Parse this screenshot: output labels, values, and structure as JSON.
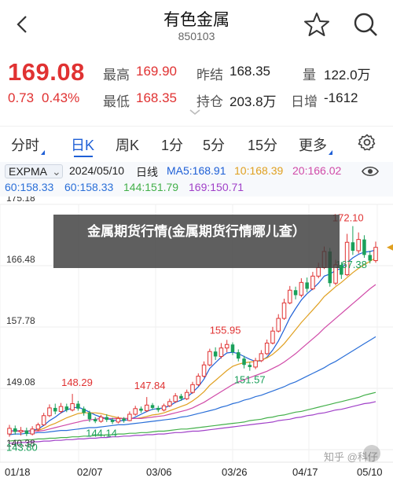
{
  "nav": {
    "title": "有色金属",
    "code": "850103"
  },
  "quote": {
    "price": "169.08",
    "change": "0.73",
    "change_pct": "0.43%",
    "high_label": "最高",
    "high": "169.90",
    "low_label": "最低",
    "low": "168.35",
    "prev_close_label": "昨结",
    "prev_close": "168.35",
    "open_int_label": "持仓",
    "open_int": "203.8万",
    "volume_label": "量",
    "volume": "122.0万",
    "daily_inc_label": "日增",
    "daily_inc": "-1612"
  },
  "periods": {
    "tabs": [
      "分时",
      "日K",
      "周K",
      "1分",
      "5分",
      "15分",
      "更多"
    ],
    "active": "日K"
  },
  "ma_bar": {
    "type": "EXPMA",
    "date": "2024/05/10",
    "kind": "日线",
    "ma5": "MA5:168.91",
    "ma10": "10:168.39",
    "ma20": "20:166.02",
    "ma60": "60:158.33",
    "ma60b": "60:158.33",
    "ma144": "144:151.79",
    "ma169": "169:150.71"
  },
  "banner": {
    "text": "金属期货行情(金属期货行情哪儿查）"
  },
  "watermark": "知乎 @科仔",
  "colors": {
    "up": "#e03232",
    "down": "#1aa05a",
    "accent": "#1e5fd6",
    "ma5": "#1e5fd6",
    "ma10": "#e0a020",
    "ma20": "#d04aa8",
    "ma60": "#2a6fd8",
    "ma144": "#43b04a",
    "ma169": "#a040c8"
  },
  "chart_data": {
    "type": "candlestick",
    "y_axis_ticks": [
      "175.18",
      "166.48",
      "157.78",
      "149.08",
      "140.38"
    ],
    "ylim": [
      140.38,
      175.18
    ],
    "x_ticks": [
      "01/18",
      "02/07",
      "03/06",
      "03/26",
      "04/17",
      "05/10"
    ],
    "annotations": {
      "max_label": "172.10",
      "current_label": "167.38",
      "labels": [
        "148.29",
        "147.84",
        "155.95",
        "151.57",
        "143.80",
        "144.14"
      ]
    },
    "candles": [
      {
        "o": 142.6,
        "c": 143.4,
        "h": 143.9,
        "l": 142.2
      },
      {
        "o": 143.4,
        "c": 142.9,
        "h": 143.8,
        "l": 142.5
      },
      {
        "o": 142.9,
        "c": 143.1,
        "h": 143.6,
        "l": 142.4
      },
      {
        "o": 143.1,
        "c": 142.6,
        "h": 143.5,
        "l": 142.3
      },
      {
        "o": 142.6,
        "c": 143.3,
        "h": 143.7,
        "l": 142.4
      },
      {
        "o": 143.3,
        "c": 143.9,
        "h": 144.2,
        "l": 143.0
      },
      {
        "o": 143.9,
        "c": 145.2,
        "h": 145.6,
        "l": 143.8
      },
      {
        "o": 145.2,
        "c": 146.3,
        "h": 146.8,
        "l": 145.0
      },
      {
        "o": 146.3,
        "c": 145.8,
        "h": 146.9,
        "l": 145.4
      },
      {
        "o": 145.8,
        "c": 146.5,
        "h": 147.0,
        "l": 145.5
      },
      {
        "o": 146.5,
        "c": 146.0,
        "h": 146.9,
        "l": 145.7
      },
      {
        "o": 146.0,
        "c": 146.9,
        "h": 148.29,
        "l": 145.8
      },
      {
        "o": 146.9,
        "c": 146.2,
        "h": 147.3,
        "l": 145.9
      },
      {
        "o": 146.2,
        "c": 145.6,
        "h": 146.5,
        "l": 145.2
      },
      {
        "o": 145.6,
        "c": 144.7,
        "h": 145.9,
        "l": 144.3
      },
      {
        "o": 144.7,
        "c": 144.4,
        "h": 145.0,
        "l": 144.14
      },
      {
        "o": 144.4,
        "c": 145.0,
        "h": 145.3,
        "l": 144.2
      },
      {
        "o": 145.0,
        "c": 144.6,
        "h": 145.4,
        "l": 144.3
      },
      {
        "o": 144.6,
        "c": 144.3,
        "h": 144.9,
        "l": 144.0
      },
      {
        "o": 144.3,
        "c": 144.8,
        "h": 145.1,
        "l": 144.1
      },
      {
        "o": 144.8,
        "c": 144.5,
        "h": 145.0,
        "l": 144.2
      },
      {
        "o": 144.5,
        "c": 145.4,
        "h": 145.8,
        "l": 144.4
      },
      {
        "o": 145.4,
        "c": 146.2,
        "h": 146.6,
        "l": 145.2
      },
      {
        "o": 146.2,
        "c": 145.9,
        "h": 146.5,
        "l": 145.6
      },
      {
        "o": 145.9,
        "c": 146.7,
        "h": 147.84,
        "l": 145.7
      },
      {
        "o": 146.7,
        "c": 146.3,
        "h": 147.0,
        "l": 146.0
      },
      {
        "o": 146.3,
        "c": 146.0,
        "h": 146.6,
        "l": 145.7
      },
      {
        "o": 146.0,
        "c": 146.6,
        "h": 146.9,
        "l": 145.8
      },
      {
        "o": 146.6,
        "c": 147.2,
        "h": 147.6,
        "l": 146.4
      },
      {
        "o": 147.2,
        "c": 148.0,
        "h": 148.4,
        "l": 147.0
      },
      {
        "o": 148.0,
        "c": 147.6,
        "h": 148.3,
        "l": 147.3
      },
      {
        "o": 147.6,
        "c": 148.5,
        "h": 148.9,
        "l": 147.4
      },
      {
        "o": 148.5,
        "c": 149.6,
        "h": 150.0,
        "l": 148.3
      },
      {
        "o": 149.6,
        "c": 150.8,
        "h": 151.2,
        "l": 149.4
      },
      {
        "o": 150.8,
        "c": 152.4,
        "h": 152.9,
        "l": 150.6
      },
      {
        "o": 152.4,
        "c": 154.3,
        "h": 154.7,
        "l": 152.2
      },
      {
        "o": 154.3,
        "c": 153.6,
        "h": 154.9,
        "l": 153.1
      },
      {
        "o": 153.6,
        "c": 154.8,
        "h": 155.5,
        "l": 153.3
      },
      {
        "o": 154.8,
        "c": 155.3,
        "h": 155.95,
        "l": 154.2
      },
      {
        "o": 155.3,
        "c": 154.2,
        "h": 155.6,
        "l": 153.8
      },
      {
        "o": 154.2,
        "c": 153.3,
        "h": 154.6,
        "l": 152.9
      },
      {
        "o": 153.3,
        "c": 152.4,
        "h": 153.7,
        "l": 151.9
      },
      {
        "o": 152.4,
        "c": 152.1,
        "h": 152.8,
        "l": 151.57
      },
      {
        "o": 152.1,
        "c": 153.0,
        "h": 153.4,
        "l": 151.8
      },
      {
        "o": 153.0,
        "c": 154.0,
        "h": 154.5,
        "l": 152.8
      },
      {
        "o": 154.0,
        "c": 155.5,
        "h": 156.0,
        "l": 153.8
      },
      {
        "o": 155.5,
        "c": 157.2,
        "h": 157.8,
        "l": 155.3
      },
      {
        "o": 157.2,
        "c": 159.0,
        "h": 159.6,
        "l": 157.0
      },
      {
        "o": 159.0,
        "c": 161.2,
        "h": 161.8,
        "l": 158.8
      },
      {
        "o": 161.2,
        "c": 163.0,
        "h": 163.6,
        "l": 161.0
      },
      {
        "o": 163.0,
        "c": 162.3,
        "h": 163.5,
        "l": 161.7
      },
      {
        "o": 162.3,
        "c": 164.1,
        "h": 164.7,
        "l": 162.0
      },
      {
        "o": 164.1,
        "c": 163.2,
        "h": 164.8,
        "l": 162.7
      },
      {
        "o": 163.2,
        "c": 165.0,
        "h": 165.6,
        "l": 163.0
      },
      {
        "o": 165.0,
        "c": 166.2,
        "h": 166.9,
        "l": 164.7
      },
      {
        "o": 166.2,
        "c": 168.5,
        "h": 169.2,
        "l": 166.0
      },
      {
        "o": 168.5,
        "c": 164.0,
        "h": 169.0,
        "l": 163.5
      },
      {
        "o": 164.0,
        "c": 166.6,
        "h": 167.3,
        "l": 163.7
      },
      {
        "o": 166.6,
        "c": 165.2,
        "h": 167.0,
        "l": 164.6
      },
      {
        "o": 165.2,
        "c": 169.8,
        "h": 171.0,
        "l": 165.0
      },
      {
        "o": 169.8,
        "c": 168.6,
        "h": 172.1,
        "l": 168.0
      },
      {
        "o": 168.6,
        "c": 170.2,
        "h": 171.2,
        "l": 168.2
      },
      {
        "o": 170.2,
        "c": 168.0,
        "h": 170.8,
        "l": 167.6
      },
      {
        "o": 168.0,
        "c": 167.2,
        "h": 168.6,
        "l": 166.8
      },
      {
        "o": 167.2,
        "c": 169.08,
        "h": 169.9,
        "l": 166.9
      }
    ],
    "ma_series": [
      {
        "name": "MA5",
        "color": "#1e5fd6",
        "values": [
          143.0,
          143.1,
          143.0,
          143.0,
          143.1,
          143.3,
          143.8,
          144.5,
          145.0,
          145.6,
          146.0,
          146.3,
          146.4,
          146.1,
          145.7,
          145.3,
          145.0,
          144.8,
          144.6,
          144.5,
          144.5,
          144.7,
          145.0,
          145.4,
          145.8,
          146.1,
          146.2,
          146.3,
          146.6,
          147.1,
          147.4,
          147.8,
          148.5,
          149.3,
          150.4,
          151.9,
          152.7,
          153.5,
          154.1,
          154.2,
          154.0,
          153.6,
          153.2,
          152.9,
          153.0,
          153.5,
          154.5,
          155.8,
          157.4,
          159.1,
          160.4,
          161.6,
          162.5,
          163.2,
          164.0,
          165.0,
          165.3,
          165.8,
          166.1,
          166.9,
          167.6,
          168.1,
          168.4,
          168.5,
          168.7
        ]
      },
      {
        "name": "MA10",
        "color": "#e0a020",
        "values": [
          143.0,
          143.0,
          143.0,
          143.0,
          143.0,
          143.1,
          143.4,
          143.8,
          144.1,
          144.5,
          144.9,
          145.2,
          145.5,
          145.6,
          145.6,
          145.6,
          145.5,
          145.3,
          145.1,
          144.9,
          144.8,
          144.8,
          144.8,
          144.9,
          145.1,
          145.3,
          145.4,
          145.6,
          145.9,
          146.2,
          146.5,
          146.8,
          147.3,
          147.9,
          148.6,
          149.5,
          150.2,
          150.9,
          151.6,
          152.2,
          152.5,
          152.7,
          152.8,
          152.9,
          153.1,
          153.4,
          153.9,
          154.6,
          155.4,
          156.4,
          157.4,
          158.4,
          159.3,
          160.2,
          161.1,
          162.1,
          162.8,
          163.5,
          164.1,
          164.8,
          165.5,
          166.1,
          166.6,
          167.1,
          167.6
        ]
      },
      {
        "name": "MA20",
        "color": "#d04aa8",
        "values": [
          143.0,
          143.0,
          143.0,
          143.0,
          143.0,
          143.0,
          143.1,
          143.3,
          143.5,
          143.7,
          143.9,
          144.1,
          144.3,
          144.5,
          144.6,
          144.7,
          144.8,
          144.8,
          144.8,
          144.8,
          144.8,
          144.8,
          144.8,
          144.8,
          144.9,
          145.0,
          145.1,
          145.2,
          145.4,
          145.6,
          145.8,
          146.0,
          146.3,
          146.7,
          147.1,
          147.6,
          148.1,
          148.6,
          149.1,
          149.6,
          150.0,
          150.3,
          150.6,
          150.9,
          151.2,
          151.5,
          151.9,
          152.3,
          152.8,
          153.4,
          154.0,
          154.7,
          155.4,
          156.1,
          156.8,
          157.6,
          158.3,
          159.0,
          159.7,
          160.4,
          161.1,
          161.8,
          162.5,
          163.2,
          163.8
        ]
      },
      {
        "name": "MA60",
        "color": "#2a6fd8",
        "values": [
          142.5,
          142.6,
          142.6,
          142.7,
          142.7,
          142.8,
          142.8,
          142.9,
          143.0,
          143.1,
          143.1,
          143.2,
          143.3,
          143.4,
          143.5,
          143.5,
          143.6,
          143.7,
          143.8,
          143.9,
          143.9,
          144.0,
          144.1,
          144.2,
          144.3,
          144.4,
          144.5,
          144.6,
          144.7,
          144.8,
          145.0,
          145.1,
          145.3,
          145.5,
          145.7,
          145.9,
          146.1,
          146.4,
          146.6,
          146.9,
          147.1,
          147.4,
          147.6,
          147.9,
          148.1,
          148.4,
          148.7,
          149.0,
          149.3,
          149.7,
          150.0,
          150.4,
          150.8,
          151.2,
          151.6,
          152.0,
          152.5,
          152.9,
          153.4,
          153.9,
          154.4,
          154.9,
          155.4,
          155.9,
          156.4
        ]
      },
      {
        "name": "MA144",
        "color": "#43b04a",
        "values": [
          141.6,
          141.7,
          141.7,
          141.8,
          141.8,
          141.9,
          141.9,
          142.0,
          142.0,
          142.1,
          142.1,
          142.2,
          142.2,
          142.3,
          142.3,
          142.4,
          142.4,
          142.5,
          142.5,
          142.6,
          142.6,
          142.7,
          142.7,
          142.8,
          142.8,
          142.9,
          143.0,
          143.0,
          143.1,
          143.2,
          143.3,
          143.3,
          143.4,
          143.5,
          143.6,
          143.7,
          143.8,
          143.9,
          144.0,
          144.1,
          144.2,
          144.3,
          144.5,
          144.6,
          144.7,
          144.9,
          145.0,
          145.2,
          145.3,
          145.5,
          145.7,
          145.8,
          146.0,
          146.2,
          146.4,
          146.6,
          146.8,
          147.0,
          147.2,
          147.4,
          147.6,
          147.8,
          148.1,
          148.3,
          148.5
        ]
      },
      {
        "name": "MA169",
        "color": "#a040c8",
        "values": [
          141.3,
          141.3,
          141.4,
          141.4,
          141.5,
          141.5,
          141.6,
          141.6,
          141.7,
          141.7,
          141.8,
          141.8,
          141.9,
          141.9,
          142.0,
          142.0,
          142.1,
          142.1,
          142.2,
          142.2,
          142.3,
          142.3,
          142.4,
          142.4,
          142.5,
          142.5,
          142.6,
          142.6,
          142.7,
          142.8,
          142.8,
          142.9,
          143.0,
          143.0,
          143.1,
          143.2,
          143.3,
          143.4,
          143.5,
          143.6,
          143.7,
          143.8,
          143.9,
          144.0,
          144.1,
          144.2,
          144.3,
          144.5,
          144.6,
          144.7,
          144.9,
          145.0,
          145.2,
          145.3,
          145.5,
          145.6,
          145.8,
          146.0,
          146.1,
          146.3,
          146.5,
          146.7,
          146.9,
          147.0,
          147.2
        ]
      }
    ]
  }
}
